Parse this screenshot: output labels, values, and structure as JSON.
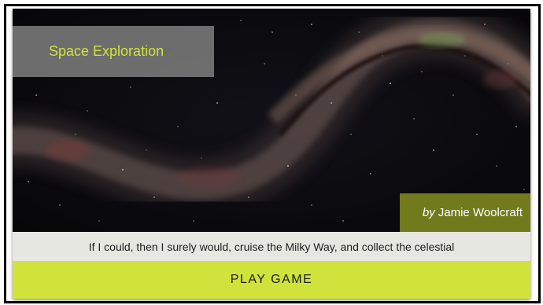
{
  "game_card": {
    "title": "Space Exploration",
    "author_prefix": "by",
    "author_name": "Jamie Woolcraft",
    "caption": "If I could, then I surely would, cruise the Milky Way, and collect the celestial",
    "play_button_label": "PLAY GAME",
    "hero_image": "milky-way-night-sky"
  },
  "colors": {
    "accent": "#cfe33a",
    "title_box": "#767676",
    "author_box": "#7c8420",
    "caption_bg": "#e7e7e2"
  }
}
